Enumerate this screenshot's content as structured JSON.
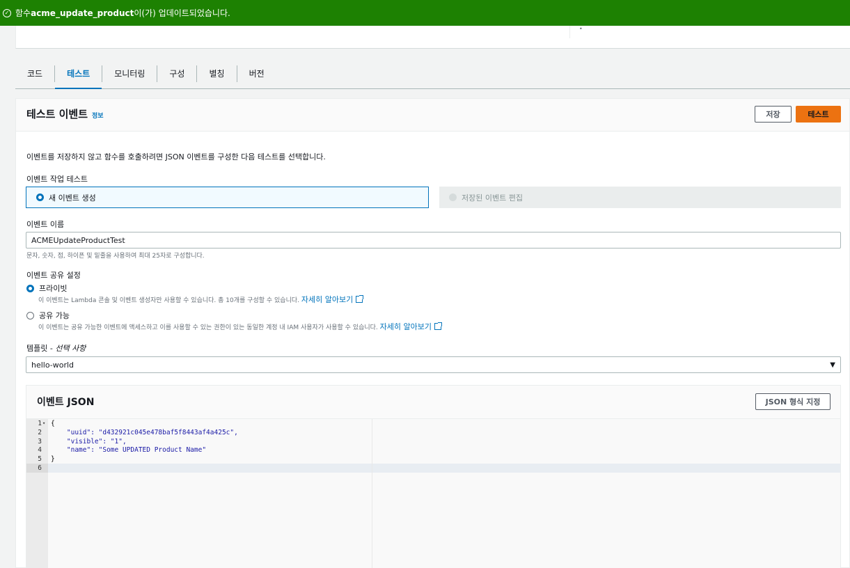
{
  "flash": {
    "prefix": "함수 ",
    "function_name": "acme_update_product",
    "suffix": "이(가) 업데이트되었습니다."
  },
  "tabs": [
    "코드",
    "테스트",
    "모니터링",
    "구성",
    "별칭",
    "버전"
  ],
  "active_tab": "테스트",
  "panel": {
    "title": "테스트 이벤트",
    "info_link": "정보",
    "save_button": "저장",
    "test_button": "테스트",
    "description": "이벤트를 저장하지 않고 함수를 호출하려면 JSON 이벤트를 구성한 다음 테스트를 선택합니다."
  },
  "event_action": {
    "label": "이벤트 작업 테스트",
    "new_option": "새 이벤트 생성",
    "saved_option": "저장된 이벤트 편집",
    "selected": "새 이벤트 생성"
  },
  "event_name": {
    "label": "이벤트 이름",
    "value": "ACMEUpdateProductTest",
    "hint": "문자, 숫자, 점, 하이픈 및 밑줄을 사용하여 최대 25자로 구성합니다."
  },
  "sharing": {
    "label": "이벤트 공유 설정",
    "private_label": "프라이빗",
    "private_desc": "이 이벤트는 Lambda 콘솔 및 이벤트 생성자만 사용할 수 있습니다. 총 10개를 구성할 수 있습니다. ",
    "shareable_label": "공유 가능",
    "shareable_desc": "이 이벤트는 공유 가능한 이벤트에 액세스하고 이를 사용할 수 있는 권한이 있는 동일한 계정 내 IAM 사용자가 사용할 수 있습니다. ",
    "learn_more": "자세히 알아보기",
    "selected": "프라이빗"
  },
  "template": {
    "label": "템플릿 - ",
    "label_optional": "선택 사항",
    "value": "hello-world"
  },
  "event_json": {
    "title": "이벤트 JSON",
    "format_button": "JSON 형식 지정",
    "line_numbers": [
      "1",
      "2",
      "3",
      "4",
      "5",
      "6"
    ],
    "lines": [
      "{",
      "    \"uuid\": \"d432921c045e478baf5f8443af4a425c\",",
      "    \"visible\": \"1\",",
      "    \"name\": \"Some UPDATED Product Name\"",
      "}",
      ""
    ],
    "active_line": 6
  },
  "colors": {
    "flash_green": "#1d8102",
    "accent_blue": "#0073bb",
    "primary_orange": "#ec7211"
  }
}
